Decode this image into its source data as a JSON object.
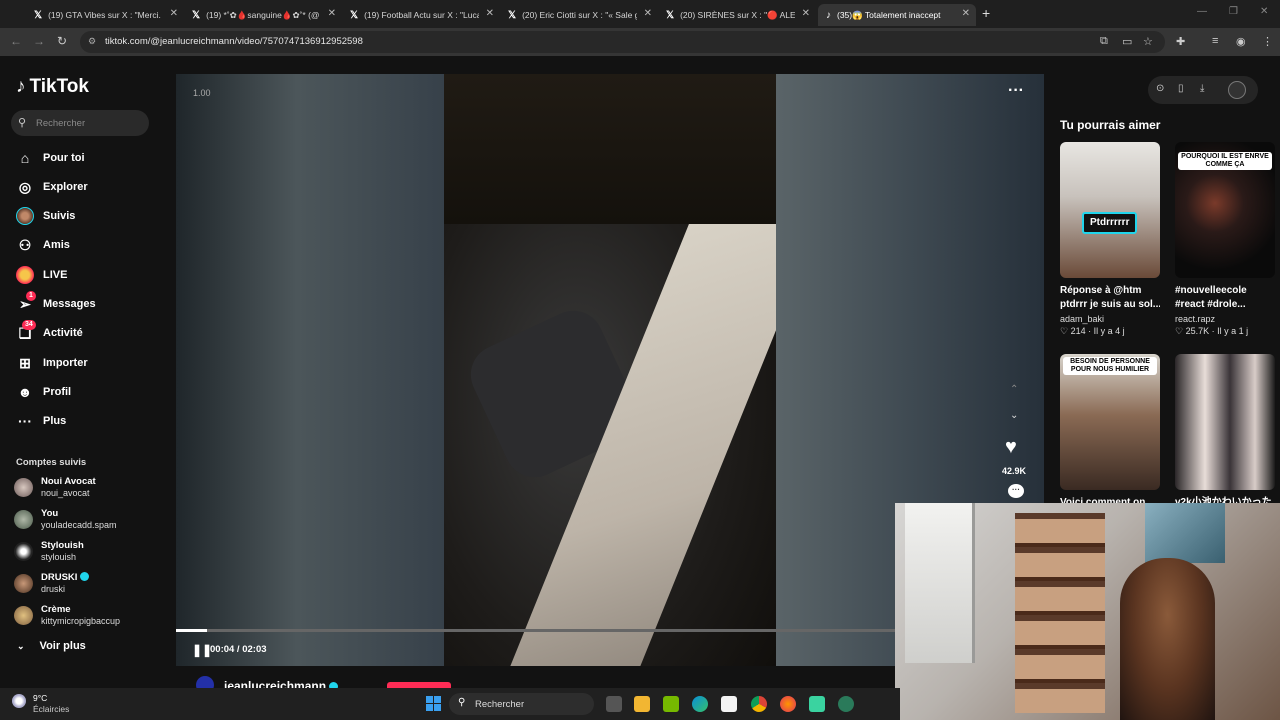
{
  "browser": {
    "tabs": [
      {
        "title": "(19) GTA Vibes sur X : \"Merci. G",
        "active": false
      },
      {
        "title": "(19) *˚✿🩸sanguine🩸✿˚* (@",
        "active": false
      },
      {
        "title": "(19) Football Actu sur X : \"Luca",
        "active": false
      },
      {
        "title": "(20) Eric Ciotti sur X : \"« Sale gu",
        "active": false
      },
      {
        "title": "(20) SIRÈNES sur X : \"🔴 ALERT",
        "active": false
      },
      {
        "title": "(35)😱 Totalement inaccept",
        "active": true
      }
    ],
    "url": "tiktok.com/@jeanlucreichmann/video/7570747136912952598"
  },
  "sidebar": {
    "logo": "TikTok",
    "search_placeholder": "Rechercher",
    "nav": [
      {
        "label": "Pour toi",
        "icon": "home-icon",
        "glyph": "⌂"
      },
      {
        "label": "Explorer",
        "icon": "compass-icon",
        "glyph": "◎"
      },
      {
        "label": "Suivis",
        "icon": "following-avatar-icon",
        "glyph": ""
      },
      {
        "label": "Amis",
        "icon": "friends-icon",
        "glyph": "⚇"
      },
      {
        "label": "LIVE",
        "icon": "live-icon",
        "glyph": ""
      },
      {
        "label": "Messages",
        "icon": "send-icon",
        "glyph": "➢",
        "badge": "1"
      },
      {
        "label": "Activité",
        "icon": "activity-icon",
        "glyph": "❏",
        "badge": "34"
      },
      {
        "label": "Importer",
        "icon": "upload-icon",
        "glyph": "⊞"
      },
      {
        "label": "Profil",
        "icon": "profile-icon",
        "glyph": "☻"
      },
      {
        "label": "Plus",
        "icon": "more-dots-icon",
        "glyph": "···"
      }
    ],
    "followed_heading": "Comptes suivis",
    "followed": [
      {
        "name": "Noui Avocat",
        "handle": "noui_avocat",
        "verified": false
      },
      {
        "name": "You",
        "handle": "youladecadd.spam",
        "verified": false
      },
      {
        "name": "Stylouish",
        "handle": "stylouish",
        "verified": false
      },
      {
        "name": "DRUSKI",
        "handle": "druski",
        "verified": true
      },
      {
        "name": "Crème",
        "handle": "kittymicropigbaccup",
        "verified": false
      }
    ],
    "see_more": "Voir plus"
  },
  "player": {
    "ratio": "1.00",
    "elapsed": "00:04",
    "total": "02:03",
    "time_label": "00:04 / 02:03",
    "progress": 0.043,
    "likes": "42.9K",
    "author": "jeanlucreichmann"
  },
  "suggestions": {
    "title": "Tu pourrais aimer",
    "cards": [
      {
        "caption1": "Réponse à @htm",
        "caption2": "ptdrrr je suis au sol...",
        "user": "adam_baki",
        "likes": "214",
        "age": "Il y a 4 j",
        "overlay": "Ptdrrrrrr"
      },
      {
        "caption1": "#nouvelleecole",
        "caption2": "#react #drole...",
        "user": "react.rapz",
        "likes": "25.7K",
        "age": "Il y a 1 j",
        "overlay": "POURQUOI IL EST ENRVE COMME ÇA"
      },
      {
        "caption1": "Voici comment on",
        "caption2": "",
        "user": "",
        "likes": "",
        "age": "",
        "overlay": "BESOIN DE PERSONNE POUR NOUS HUMILIER"
      },
      {
        "caption1": "v2k小池かわいかった",
        "caption2": "",
        "user": "",
        "likes": "",
        "age": "",
        "overlay": ""
      }
    ]
  },
  "taskbar": {
    "temperature": "9°C",
    "weather": "Éclaircies",
    "search_label": "Rechercher"
  }
}
